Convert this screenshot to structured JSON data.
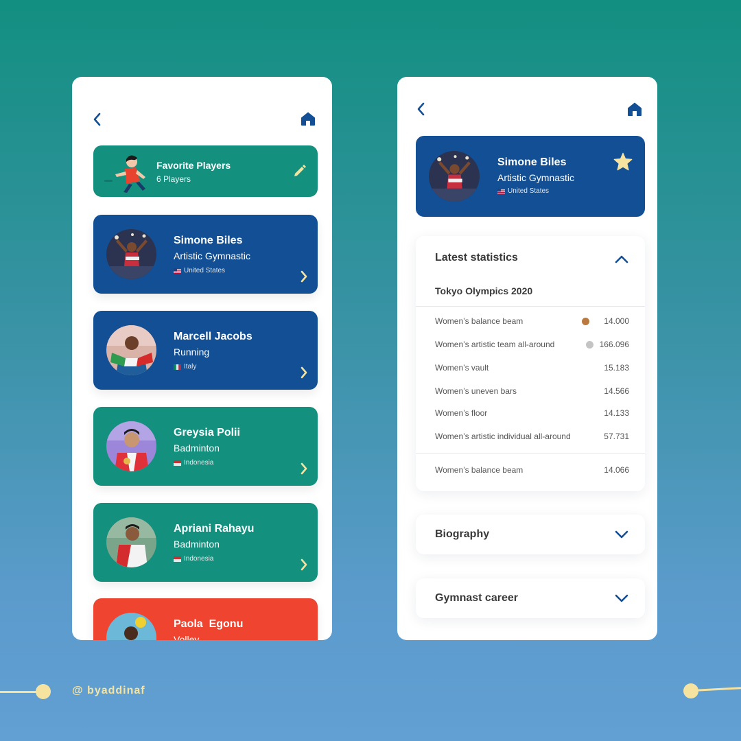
{
  "favorites": {
    "title": "Favorite Players",
    "count_label": "6 Players"
  },
  "players": [
    {
      "name": "Simone Biles",
      "sport": "Artistic Gymnastic",
      "country": "United States",
      "flag": "us",
      "color": "#124f94"
    },
    {
      "name": "Marcell Jacobs",
      "sport": "Running",
      "country": "Italy",
      "flag": "it",
      "color": "#124f94"
    },
    {
      "name": "Greysia Polii",
      "sport": "Badminton",
      "country": "Indonesia",
      "flag": "id",
      "color": "#14907f"
    },
    {
      "name": "Apriani Rahayu",
      "sport": "Badminton",
      "country": "Indonesia",
      "flag": "id",
      "color": "#14907f"
    },
    {
      "name": "Paola  Egonu",
      "sport": "Volley",
      "country": "",
      "flag": "",
      "color": "#ee4430"
    }
  ],
  "detail": {
    "name": "Simone Biles",
    "sport": "Artistic Gymnastic",
    "country": "United States"
  },
  "stats": {
    "title": "Latest statistics",
    "event": "Tokyo Olympics 2020",
    "rows": [
      {
        "label": "Women’s balance beam",
        "value": "14.000",
        "medal": "bronze"
      },
      {
        "label": "Women’s artistic team all-around",
        "value": "166.096",
        "medal": "silver"
      },
      {
        "label": "Women’s vault",
        "value": "15.183",
        "medal": ""
      },
      {
        "label": "Women’s uneven bars",
        "value": "14.566",
        "medal": ""
      },
      {
        "label": "Women’s floor",
        "value": "14.133",
        "medal": ""
      },
      {
        "label": "Women’s artistic individual all-around",
        "value": "57.731",
        "medal": ""
      }
    ],
    "extra_row": {
      "label": "Women’s balance beam",
      "value": "14.066"
    }
  },
  "sections": {
    "biography": "Biography",
    "career": "Gymnast career"
  },
  "credit": "@ byaddinaf",
  "colors": {
    "navy": "#124f94",
    "teal": "#14907f",
    "red": "#ee4430",
    "bronze": "#b9793f",
    "silver": "#c4c4c4",
    "star": "#f6e3a0"
  }
}
